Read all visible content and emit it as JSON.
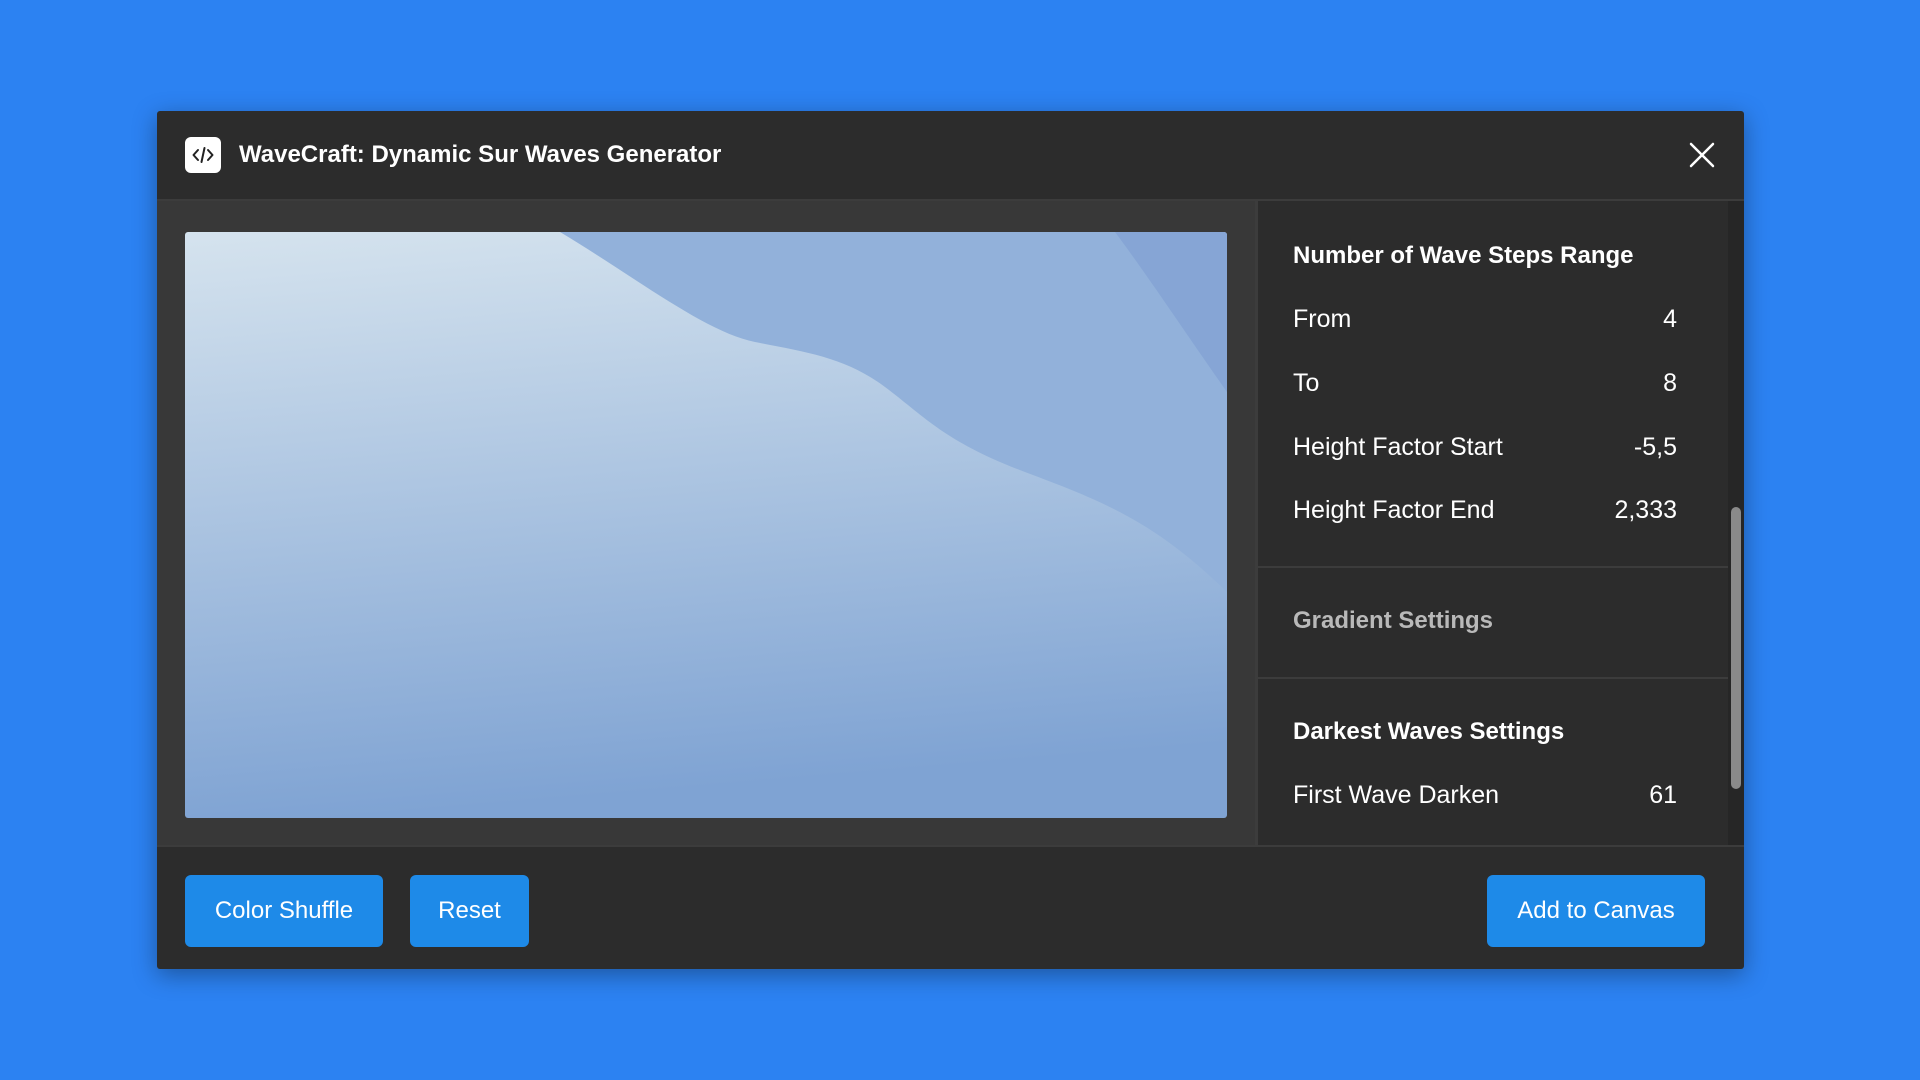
{
  "window": {
    "title": "WaveCraft: Dynamic Sur Waves Generator",
    "icon": "code-icon",
    "close_icon": "close-icon"
  },
  "preview": {
    "colors": {
      "gradient_top": "#d5e3ee",
      "gradient_bottom": "#7fa3d3",
      "back_wave": "#92b1da",
      "middle_wave": "#86a5d5"
    }
  },
  "settings": {
    "wave_steps": {
      "title": "Number of Wave Steps Range",
      "rows": [
        {
          "label": "From",
          "value": "4"
        },
        {
          "label": "To",
          "value": "8"
        },
        {
          "label": "Height Factor Start",
          "value": "-5,5"
        },
        {
          "label": "Height Factor End",
          "value": "2,333"
        }
      ]
    },
    "gradient": {
      "title": "Gradient Settings"
    },
    "darkest": {
      "title": "Darkest Waves Settings",
      "rows": [
        {
          "label": "First Wave Darken",
          "value": "61"
        }
      ]
    }
  },
  "footer": {
    "color_shuffle": "Color Shuffle",
    "reset": "Reset",
    "add_to_canvas": "Add to Canvas"
  },
  "colors": {
    "background": "#2c82f2",
    "dialog": "#2c2c2c",
    "button": "#1e8ae8"
  }
}
